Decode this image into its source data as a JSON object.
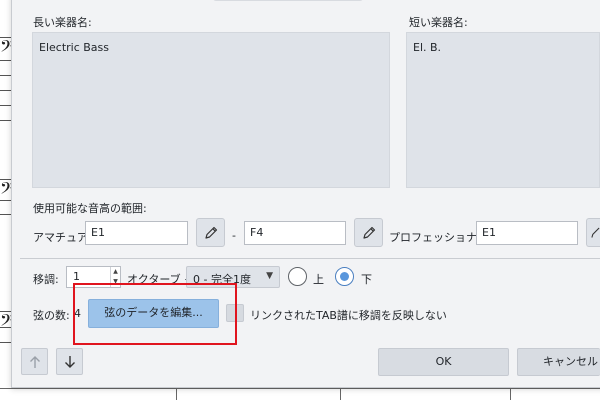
{
  "dialog": {
    "long_name": {
      "label": "長い楽器名:",
      "value": "Electric Bass"
    },
    "short_name": {
      "label": "短い楽器名:",
      "value": "El. B."
    },
    "range": {
      "label": "使用可能な音高の範囲:",
      "amateur_label": "アマチュア:",
      "amateur_low": "E1",
      "dash": "-",
      "amateur_high": "F4",
      "professional_label": "プロフェッショナル:",
      "professional_low": "E1"
    },
    "transposition": {
      "label": "移調:",
      "octave_value": "1",
      "octave_label": "オクターブ +",
      "interval_value": "0 - 完全1度",
      "up_label": "上",
      "down_label": "下",
      "direction_selected": "down"
    },
    "strings": {
      "count_label": "弦の数:",
      "count_value": "4",
      "edit_button": "弦のデータを編集...",
      "linked_tab_label": "リンクされたTAB譜に移調を反映しない"
    },
    "footer": {
      "ok": "OK",
      "cancel": "キャンセル"
    }
  },
  "icons": {
    "edit": "pencil-icon",
    "move_up": "arrow-up-icon",
    "move_down": "arrow-down-icon",
    "clef": "bass-clef-icon"
  },
  "colors": {
    "primary_button": "#9cc3ea",
    "radio_selected": "#5b97dc",
    "highlight": "#e0141e",
    "dialog_bg": "#f2f3f5"
  }
}
